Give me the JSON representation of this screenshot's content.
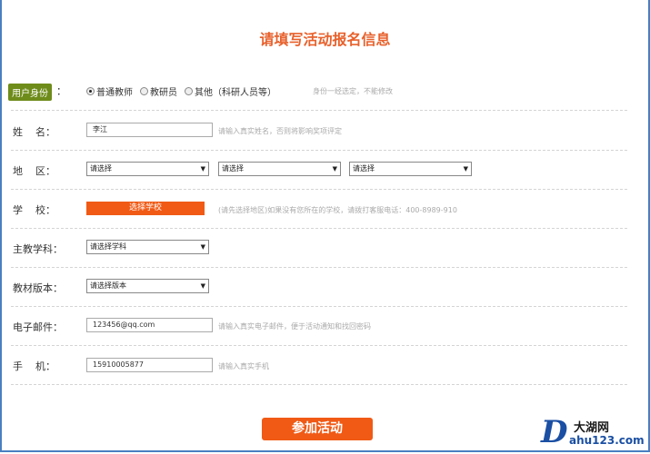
{
  "title": "请填写活动报名信息",
  "identity": {
    "label": "用户身份",
    "colon": "：",
    "options": [
      {
        "label": "普通教师",
        "selected": true
      },
      {
        "label": "教研员",
        "selected": false
      },
      {
        "label": "其他（科研人员等）",
        "selected": false
      }
    ],
    "hint": "身份一经选定，不能修改"
  },
  "name": {
    "label": "姓    名：",
    "value": "李江",
    "hint": "请输入真实姓名，否则将影响奖项评定"
  },
  "region": {
    "label": "地    区：",
    "selects": [
      "请选择",
      "请选择",
      "请选择"
    ]
  },
  "school": {
    "label": "学    校：",
    "button": "选择学校",
    "hint": "(请先选择地区)如果没有您所在的学校，请拨打客服电话：400-8989-910"
  },
  "subject": {
    "label": "主教学科：",
    "select": "请选择学科"
  },
  "edition": {
    "label": "教材版本：",
    "select": "请选择版本"
  },
  "email": {
    "label": "电子邮件：",
    "value": "123456@qq.com",
    "hint": "请输入真实电子邮件，便于活动通知和找回密码"
  },
  "phone": {
    "label": "手    机：",
    "value": "15910005877",
    "hint": "请输入真实手机"
  },
  "submit": "参加活动",
  "logo": {
    "mark": "D",
    "name": "大湖网",
    "url": "ahu123.com"
  },
  "icons": {
    "dropdown": "triangle-down"
  }
}
